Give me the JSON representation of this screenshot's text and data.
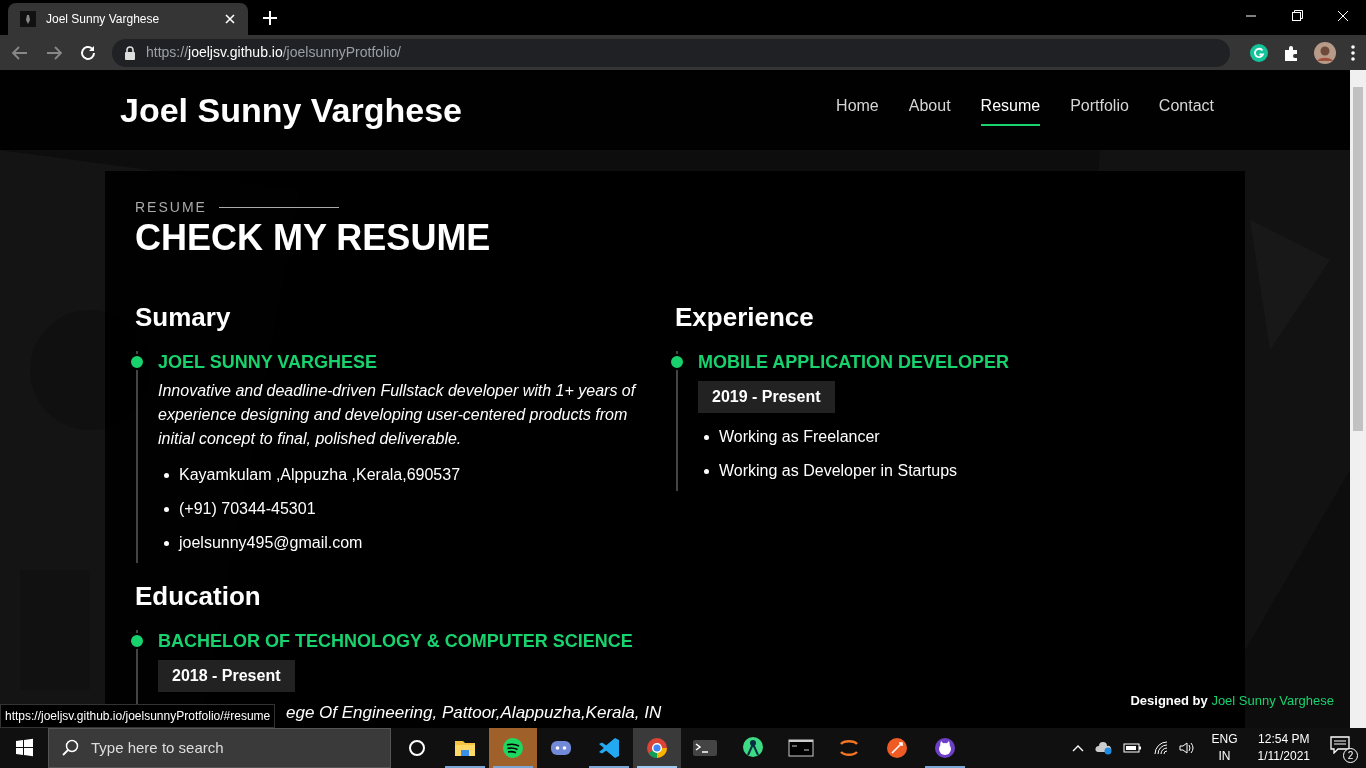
{
  "browser": {
    "tab_title": "Joel Sunny Varghese",
    "url": {
      "scheme": "https://",
      "host": "joeljsv.github.io",
      "path": "/joelsunnyProtfolio/"
    },
    "status_url": "https://joeljsv.github.io/joelsunnyProtfolio/#resume"
  },
  "site": {
    "brand": "Joel Sunny Varghese",
    "nav": [
      {
        "label": "Home",
        "selected": false
      },
      {
        "label": "About",
        "selected": false
      },
      {
        "label": "Resume",
        "selected": true
      },
      {
        "label": "Portfolio",
        "selected": false
      },
      {
        "label": "Contact",
        "selected": false
      }
    ],
    "section_label": "RESUME",
    "heading": "CHECK MY RESUME",
    "summary": {
      "title": "Sumary",
      "name": "JOEL SUNNY VARGHESE",
      "description": "Innovative and deadline-driven Fullstack developer with 1+ years of experience designing and developing user-centered products from initial concept to final, polished deliverable.",
      "items": [
        "Kayamkulam ,Alppuzha ,Kerala,690537",
        "(+91) 70344-45301",
        "joelsunny495@gmail.com"
      ]
    },
    "education": {
      "title": "Education",
      "entries": [
        {
          "title": "BACHELOR OF TECHNOLOGY & COMPUTER SCIENCE",
          "period": "2018 - Present",
          "detail": "ege Of Engineering, Pattoor,Alappuzha,Kerala, IN"
        }
      ]
    },
    "experience": {
      "title": "Experience",
      "entries": [
        {
          "title": "MOBILE APPLICATION DEVELOPER",
          "period": "2019 - Present",
          "items": [
            "Working as Freelancer",
            "Working as Developer in Startups"
          ]
        }
      ]
    },
    "footer": {
      "prefix": "Designed by",
      "name": "Joel Sunny Varghese"
    }
  },
  "taskbar": {
    "search_placeholder": "Type here to search",
    "apps": [
      {
        "kind": "cortana",
        "running": false,
        "selected": false,
        "flashing": false
      },
      {
        "kind": "explorer",
        "running": true,
        "selected": false,
        "flashing": false
      },
      {
        "kind": "spotify",
        "running": true,
        "selected": false,
        "flashing": true
      },
      {
        "kind": "discord",
        "running": false,
        "selected": false,
        "flashing": false
      },
      {
        "kind": "vscode",
        "running": true,
        "selected": false,
        "flashing": false
      },
      {
        "kind": "chrome",
        "running": true,
        "selected": true,
        "flashing": false
      },
      {
        "kind": "terminal",
        "running": false,
        "selected": false,
        "flashing": false
      },
      {
        "kind": "android",
        "running": false,
        "selected": false,
        "flashing": false
      },
      {
        "kind": "cmd",
        "running": false,
        "selected": false,
        "flashing": false
      },
      {
        "kind": "jupyter",
        "running": false,
        "selected": false,
        "flashing": false
      },
      {
        "kind": "postman",
        "running": false,
        "selected": false,
        "flashing": false
      },
      {
        "kind": "github",
        "running": true,
        "selected": false,
        "flashing": false
      }
    ],
    "language": "ENG",
    "region": "IN",
    "time": "12:54 PM",
    "date": "1/11/2021",
    "notifications": "2"
  }
}
